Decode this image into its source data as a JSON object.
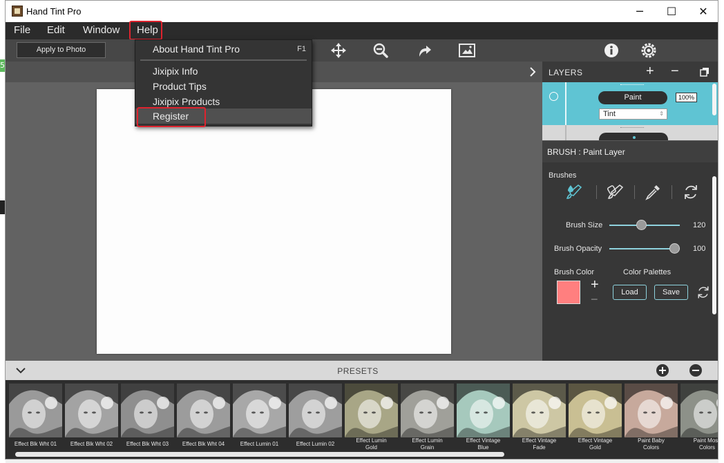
{
  "window": {
    "title": "Hand Tint Pro",
    "controls": {
      "minimize": "─",
      "maximize": "☐",
      "close": "✕"
    }
  },
  "menubar": {
    "items": [
      "File",
      "Edit",
      "Window",
      "Help"
    ],
    "open_menu": "Help"
  },
  "help_menu": {
    "items": [
      {
        "label": "About Hand Tint Pro",
        "shortcut": "F1"
      },
      {
        "label": "Jixipix Info"
      },
      {
        "label": "Product Tips"
      },
      {
        "label": "Jixipix Products"
      },
      {
        "label": "Register"
      }
    ],
    "highlighted": "Register"
  },
  "toolbar": {
    "apply_label": "Apply to Photo",
    "icons": [
      "move-icon",
      "zoom-out-icon",
      "redo-arrow-icon",
      "photo-frame-icon",
      "info-icon",
      "settings-gear-icon"
    ]
  },
  "layers": {
    "title": "LAYERS",
    "add": "+",
    "remove": "−",
    "layer": {
      "name": "Paint",
      "opacity": "100%",
      "mode": "Tint"
    }
  },
  "brush": {
    "header": "BRUSH : Paint Layer",
    "brushes_label": "Brushes",
    "size_label": "Brush Size",
    "size_value": "120",
    "size_fraction": 0.45,
    "opacity_label": "Brush Opacity",
    "opacity_value": "100",
    "opacity_fraction": 1.0,
    "color_label": "Brush Color",
    "color": "#ff7f7f",
    "palettes_label": "Color Palettes",
    "plus": "+",
    "minus": "−",
    "load": "Load",
    "save": "Save"
  },
  "presets": {
    "title": "PRESETS",
    "items": [
      {
        "line1": "Effect Blk Wht 01",
        "line2": "",
        "tint": "#9a9a9a"
      },
      {
        "line1": "Effect Blk Wht 02",
        "line2": "",
        "tint": "#a3a3a3"
      },
      {
        "line1": "Effect Blk Wht 03",
        "line2": "",
        "tint": "#8f8f8f"
      },
      {
        "line1": "Effect Blk Wht 04",
        "line2": "",
        "tint": "#9c9c9c"
      },
      {
        "line1": "Effect Lumin 01",
        "line2": "",
        "tint": "#a8a8a8"
      },
      {
        "line1": "Effect Lumin 02",
        "line2": "",
        "tint": "#9e9e9e"
      },
      {
        "line1": "Effect Lumin",
        "line2": "Gold",
        "tint": "#a8a686"
      },
      {
        "line1": "Effect Lumin",
        "line2": "Grain",
        "tint": "#a0a09a"
      },
      {
        "line1": "Effect Vintage",
        "line2": "Blue",
        "tint": "#a6c9bd"
      },
      {
        "line1": "Effect Vintage",
        "line2": "Fade",
        "tint": "#cdc7a4"
      },
      {
        "line1": "Effect Vintage",
        "line2": "Gold",
        "tint": "#c9bf93"
      },
      {
        "line1": "Paint Baby",
        "line2": "Colors",
        "tint": "#c7a99c"
      },
      {
        "line1": "Paint Moss",
        "line2": "Colors",
        "tint": "#8d9189"
      }
    ]
  },
  "background_fragments": [
    "5"
  ]
}
